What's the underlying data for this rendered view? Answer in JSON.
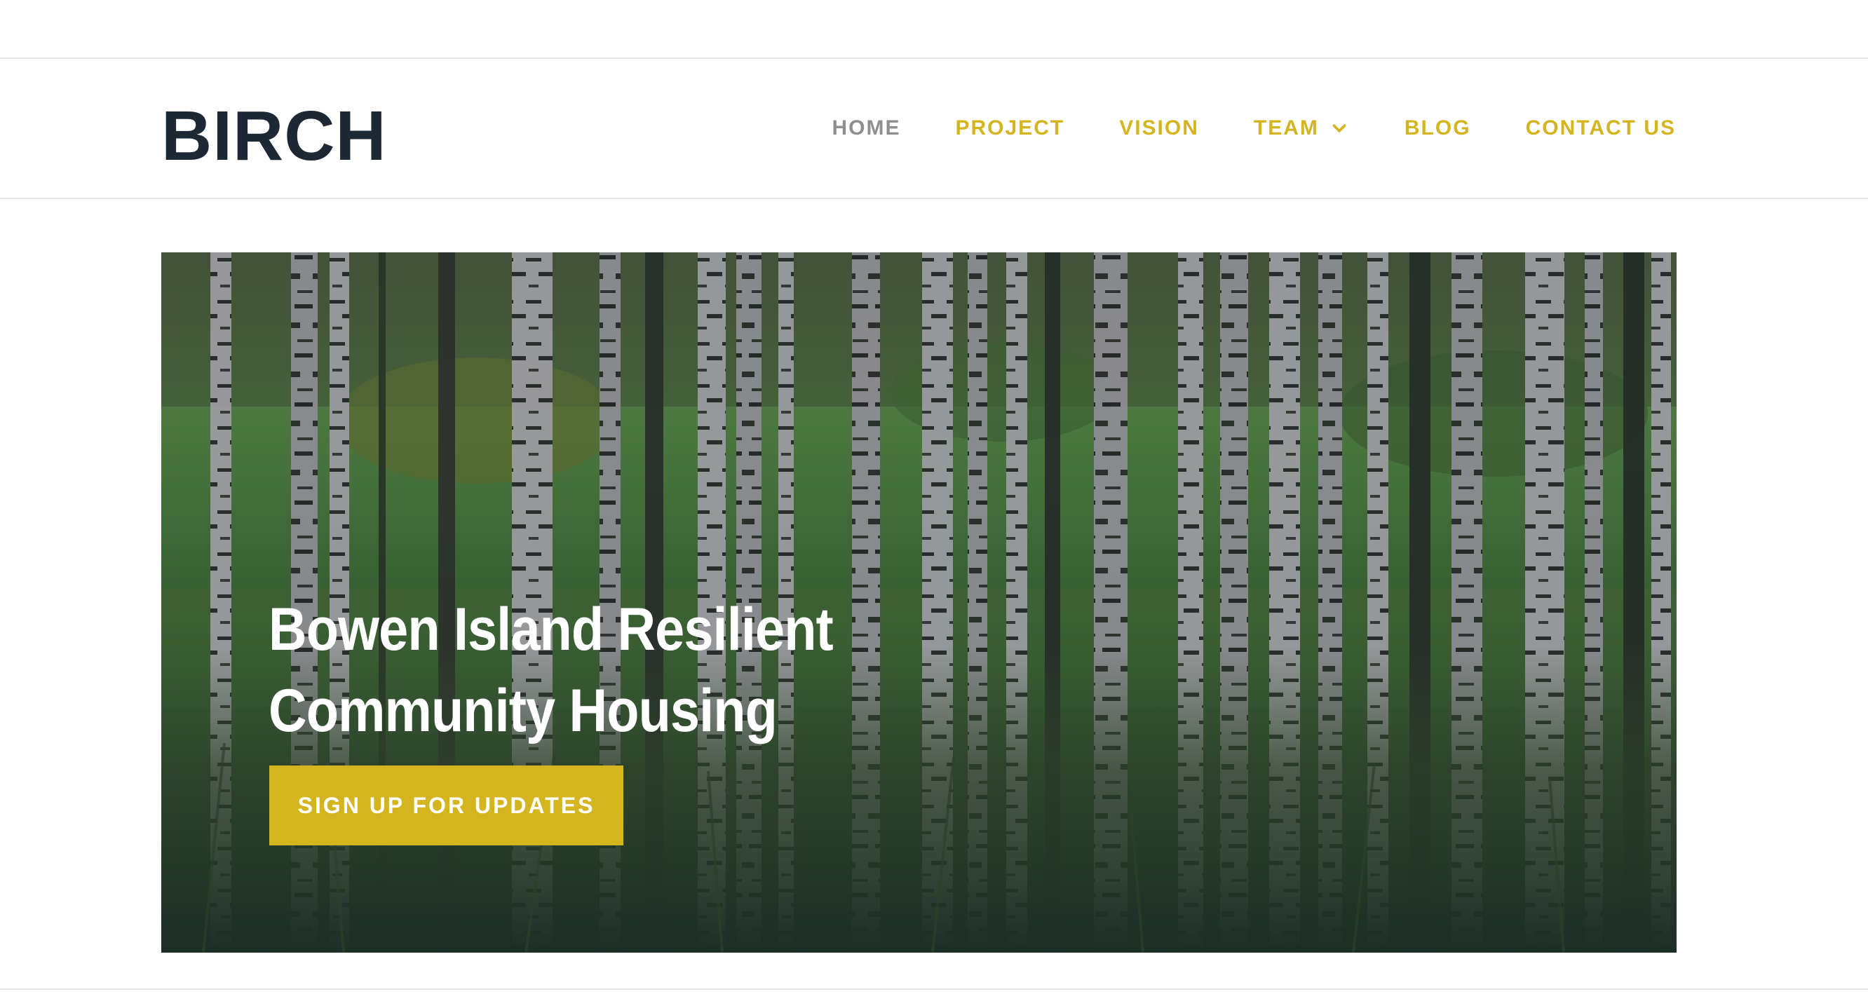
{
  "site": {
    "logo": "BIRCH"
  },
  "nav": {
    "items": [
      {
        "label": "HOME",
        "active": true
      },
      {
        "label": "PROJECT",
        "active": false
      },
      {
        "label": "VISION",
        "active": false
      },
      {
        "label": "TEAM",
        "active": false,
        "has_dropdown": true
      },
      {
        "label": "BLOG",
        "active": false
      },
      {
        "label": "CONTACT US",
        "active": false
      }
    ]
  },
  "hero": {
    "title_line1": "Bowen Island Resilient",
    "title_line2": "Community Housing",
    "cta_label": "SIGN UP FOR UPDATES",
    "background": "birch-forest-photo"
  },
  "colors": {
    "accent": "#d4b520",
    "logo": "#1c2833",
    "nav_active": "#8e8e8e",
    "divider": "#e6e6e6"
  }
}
